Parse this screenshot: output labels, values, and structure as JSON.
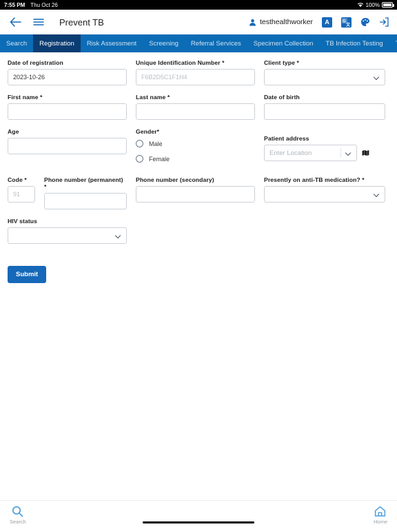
{
  "statusbar": {
    "time": "7:55 PM",
    "date": "Thu Oct 26",
    "battery_percent": "100%",
    "wifi_icon": "wifi-icon",
    "battery_icon": "battery-full-icon"
  },
  "header": {
    "back_icon": "back-arrow-icon",
    "menu_icon": "hamburger-menu-icon",
    "title": "Prevent TB",
    "user": "testhealthworker",
    "user_icon": "person-icon",
    "actions": [
      {
        "name": "font-size-icon",
        "glyph": "A"
      },
      {
        "name": "translate-icon",
        "glyph": "G"
      },
      {
        "name": "theme-palette-icon",
        "glyph": ""
      },
      {
        "name": "logout-icon",
        "glyph": ""
      }
    ]
  },
  "tabs": [
    {
      "label": "Search",
      "active": false
    },
    {
      "label": "Registration",
      "active": true
    },
    {
      "label": "Risk Assessment",
      "active": false
    },
    {
      "label": "Screening",
      "active": false
    },
    {
      "label": "Referral Services",
      "active": false
    },
    {
      "label": "Specimen Collection",
      "active": false
    },
    {
      "label": "TB Infection Testing",
      "active": false
    },
    {
      "label": "TB",
      "active": false
    }
  ],
  "tab_scroll_right_icon": "chevron-right-icon",
  "form": {
    "date_of_registration": {
      "label": "Date of registration",
      "value": "2023-10-26"
    },
    "unique_identification_number": {
      "label": "Unique Identification Number *",
      "placeholder": "F6B2D5C1F1H4",
      "value": ""
    },
    "client_type": {
      "label": "Client type *",
      "value": ""
    },
    "first_name": {
      "label": "First name *",
      "value": ""
    },
    "last_name": {
      "label": "Last name *",
      "value": ""
    },
    "date_of_birth": {
      "label": "Date of birth",
      "value": ""
    },
    "age": {
      "label": "Age",
      "value": ""
    },
    "gender": {
      "label": "Gender*",
      "options": [
        {
          "label": "Male",
          "selected": false
        },
        {
          "label": "Female",
          "selected": false
        }
      ]
    },
    "patient_address": {
      "label": "Patient address",
      "placeholder": "Enter Location",
      "value": "",
      "map_icon": "map-icon"
    },
    "code": {
      "label": "Code *",
      "placeholder": "91",
      "value": ""
    },
    "phone_permanent": {
      "label": "Phone number (permanent) *",
      "value": ""
    },
    "phone_secondary": {
      "label": "Phone number (secondary)",
      "value": ""
    },
    "anti_tb_medication": {
      "label": "Presently on anti-TB medication? *",
      "value": ""
    },
    "hiv_status": {
      "label": "HIV status",
      "value": ""
    },
    "submit_label": "Submit"
  },
  "bottom_nav": [
    {
      "label": "Search",
      "icon": "search-icon"
    },
    {
      "label": "Home",
      "icon": "home-icon"
    }
  ],
  "colors": {
    "tabbar_blue": "#0c6cb5",
    "active_tab_blue": "#0b3d73",
    "accent_blue": "#1668b8"
  }
}
